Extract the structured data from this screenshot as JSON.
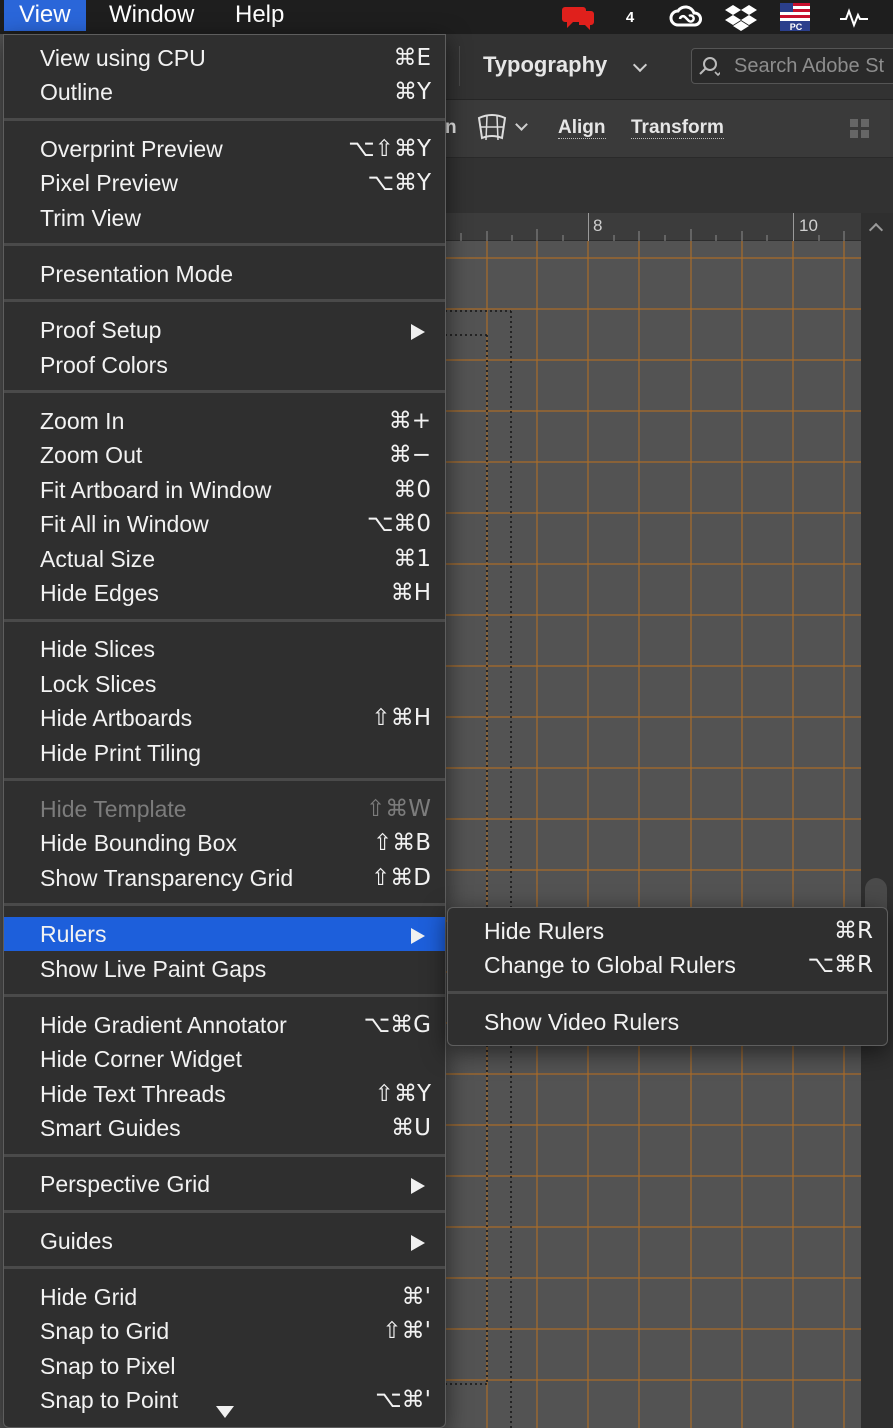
{
  "menubar": {
    "items": [
      "View",
      "Window",
      "Help"
    ],
    "badge_count": "4",
    "flag_label": "PC"
  },
  "control_bar": {
    "workspace": "Typography",
    "search_placeholder": "Search Adobe St"
  },
  "properties_bar": {
    "align": "Align",
    "transform": "Transform",
    "clipped_prefix": "n"
  },
  "ruler": {
    "marks": [
      "8",
      "10"
    ]
  },
  "view_menu": {
    "groups": [
      [
        {
          "label": "View using CPU",
          "shortcut": "⌘E"
        },
        {
          "label": "Outline",
          "shortcut": "⌘Y"
        }
      ],
      [
        {
          "label": "Overprint Preview",
          "shortcut": "⌥⇧⌘Y"
        },
        {
          "label": "Pixel Preview",
          "shortcut": "⌥⌘Y"
        },
        {
          "label": "Trim View",
          "shortcut": ""
        }
      ],
      [
        {
          "label": "Presentation Mode",
          "shortcut": ""
        }
      ],
      [
        {
          "label": "Proof Setup",
          "shortcut": "",
          "submenu": true
        },
        {
          "label": "Proof Colors",
          "shortcut": ""
        }
      ],
      [
        {
          "label": "Zoom In",
          "shortcut": "⌘+"
        },
        {
          "label": "Zoom Out",
          "shortcut": "⌘−"
        },
        {
          "label": "Fit Artboard in Window",
          "shortcut": "⌘0"
        },
        {
          "label": "Fit All in Window",
          "shortcut": "⌥⌘0"
        },
        {
          "label": "Actual Size",
          "shortcut": "⌘1"
        },
        {
          "label": "Hide Edges",
          "shortcut": "⌘H"
        }
      ],
      [
        {
          "label": "Hide Slices",
          "shortcut": ""
        },
        {
          "label": "Lock Slices",
          "shortcut": ""
        },
        {
          "label": "Hide Artboards",
          "shortcut": "⇧⌘H"
        },
        {
          "label": "Hide Print Tiling",
          "shortcut": ""
        }
      ],
      [
        {
          "label": "Hide Template",
          "shortcut": "⇧⌘W",
          "disabled": true
        },
        {
          "label": "Hide Bounding Box",
          "shortcut": "⇧⌘B"
        },
        {
          "label": "Show Transparency Grid",
          "shortcut": "⇧⌘D"
        }
      ],
      [
        {
          "label": "Rulers",
          "shortcut": "",
          "submenu": true,
          "highlighted": true
        },
        {
          "label": "Show Live Paint Gaps",
          "shortcut": ""
        }
      ],
      [
        {
          "label": "Hide Gradient Annotator",
          "shortcut": "⌥⌘G"
        },
        {
          "label": "Hide Corner Widget",
          "shortcut": ""
        },
        {
          "label": "Hide Text Threads",
          "shortcut": "⇧⌘Y"
        },
        {
          "label": "Smart Guides",
          "shortcut": "⌘U"
        }
      ],
      [
        {
          "label": "Perspective Grid",
          "shortcut": "",
          "submenu": true
        }
      ],
      [
        {
          "label": "Guides",
          "shortcut": "",
          "submenu": true
        }
      ],
      [
        {
          "label": "Hide Grid",
          "shortcut": "⌘'"
        },
        {
          "label": "Snap to Grid",
          "shortcut": "⇧⌘'"
        },
        {
          "label": "Snap to Pixel",
          "shortcut": ""
        },
        {
          "label": "Snap to Point",
          "shortcut": "⌥⌘'"
        }
      ]
    ]
  },
  "rulers_submenu": {
    "groups": [
      [
        {
          "label": "Hide Rulers",
          "shortcut": "⌘R"
        },
        {
          "label": "Change to Global Rulers",
          "shortcut": "⌥⌘R"
        }
      ],
      [
        {
          "label": "Show Video Rulers",
          "shortcut": ""
        }
      ]
    ]
  },
  "colors": {
    "highlight": "#1d5fdb",
    "grid_line": "#c07a2c",
    "menu_bg": "#2f2f2f"
  }
}
